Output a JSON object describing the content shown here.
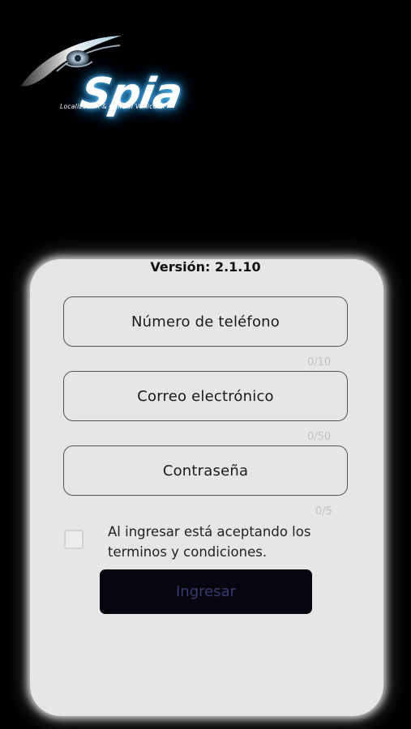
{
  "logo": {
    "wordmark": "Spia",
    "tagline": "Localización & Control Vehicular"
  },
  "login": {
    "version_text": "Versión: 2.1.10",
    "fields": [
      {
        "label": "Número de teléfono",
        "counter": "0/10"
      },
      {
        "label": "Correo electrónico",
        "counter": "0/50"
      },
      {
        "label": "Contraseña",
        "counter": "0/5"
      }
    ],
    "terms_checked": false,
    "terms_text": "Al ingresar está aceptando los terminos y condiciones.",
    "submit_label": "Ingresar"
  },
  "colors": {
    "background": "#000000",
    "card": "#e6e6e6",
    "button": "#050510",
    "button_text": "#3d3a6e",
    "logo_glow": "#2a8fd6"
  }
}
